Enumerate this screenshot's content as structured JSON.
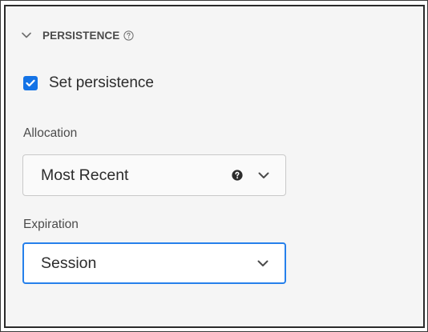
{
  "section": {
    "title": "PERSISTENCE",
    "chevron_icon": "chevron-down-icon",
    "info_icon": "info-icon"
  },
  "persistence_checkbox": {
    "label": "Set persistence",
    "checked": true,
    "color": "#1473e6"
  },
  "allocation": {
    "label": "Allocation",
    "value": "Most Recent",
    "help_icon": "help-icon",
    "chevron_icon": "chevron-down-icon"
  },
  "expiration": {
    "label": "Expiration",
    "value": "Session",
    "focused": true,
    "focus_color": "#2680eb",
    "chevron_icon": "chevron-down-icon"
  }
}
